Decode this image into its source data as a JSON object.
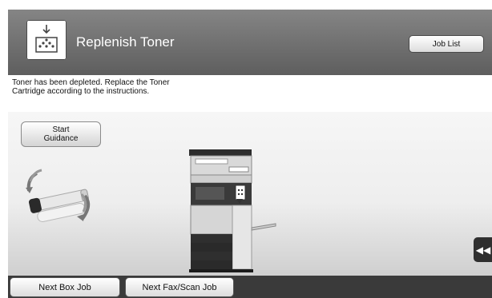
{
  "header": {
    "title": "Replenish Toner",
    "icon": "toner-icon",
    "job_list_label": "Job List"
  },
  "message": {
    "line1": "Toner has been depleted. Replace the Toner",
    "line2": "Cartridge according to the instructions."
  },
  "guidance": {
    "line1": "Start",
    "line2": "Guidance"
  },
  "side_button_icon": "double-chevron-left-icon",
  "footer": {
    "next_box_job_label": "Next Box Job",
    "next_fax_scan_job_label": "Next Fax/Scan Job"
  }
}
